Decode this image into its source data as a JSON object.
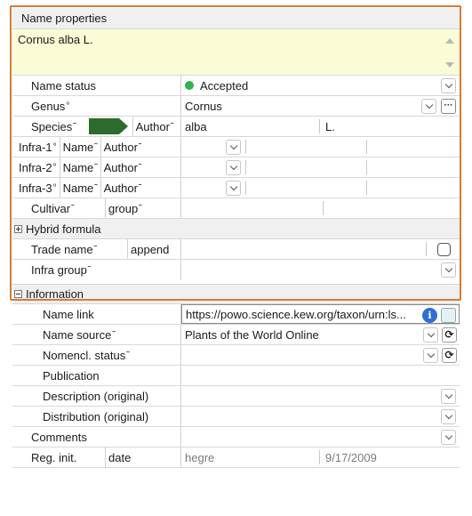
{
  "name_properties": {
    "header": "Name properties",
    "full_name": "Cornus alba L."
  },
  "rows": {
    "name_status": {
      "label": "Name status",
      "value": "Accepted",
      "status_color": "#2fb34a"
    },
    "genus": {
      "label": "Genus",
      "value": "Cornus"
    },
    "species": {
      "label": "Species",
      "author_label": "Author",
      "value": "alba",
      "author": "L."
    },
    "infra1": {
      "label": "Infra-1",
      "name_label": "Name",
      "author_label": "Author"
    },
    "infra2": {
      "label": "Infra-2",
      "name_label": "Name",
      "author_label": "Author"
    },
    "infra3": {
      "label": "Infra-3",
      "name_label": "Name",
      "author_label": "Author"
    },
    "cultivar": {
      "label": "Cultivar",
      "group_label": "group"
    },
    "hybrid_formula": {
      "label": "Hybrid formula"
    },
    "trade_name": {
      "label": "Trade name",
      "append_label": "append"
    },
    "infra_group": {
      "label": "Infra group"
    }
  },
  "information": {
    "header": "Information",
    "name_link": {
      "label": "Name link",
      "value": "https://powo.science.kew.org/taxon/urn:ls..."
    },
    "name_source": {
      "label": "Name source",
      "value": "Plants of the World Online"
    },
    "nomencl_status": {
      "label": "Nomencl. status"
    },
    "publication": {
      "label": "Publication"
    },
    "description": {
      "label": "Description (original)"
    },
    "distribution": {
      "label": "Distribution (original)"
    }
  },
  "comments": {
    "label": "Comments"
  },
  "reg_init": {
    "label": "Reg. init.",
    "date_label": "date",
    "user": "hegre",
    "date": "9/17/2009"
  },
  "marks": {
    "degree": "°",
    "tilde": "˜"
  },
  "colors": {
    "accent_frame": "#d27d36",
    "name_bg": "#fbfbd6",
    "species_arrow": "#2e6b2e"
  }
}
